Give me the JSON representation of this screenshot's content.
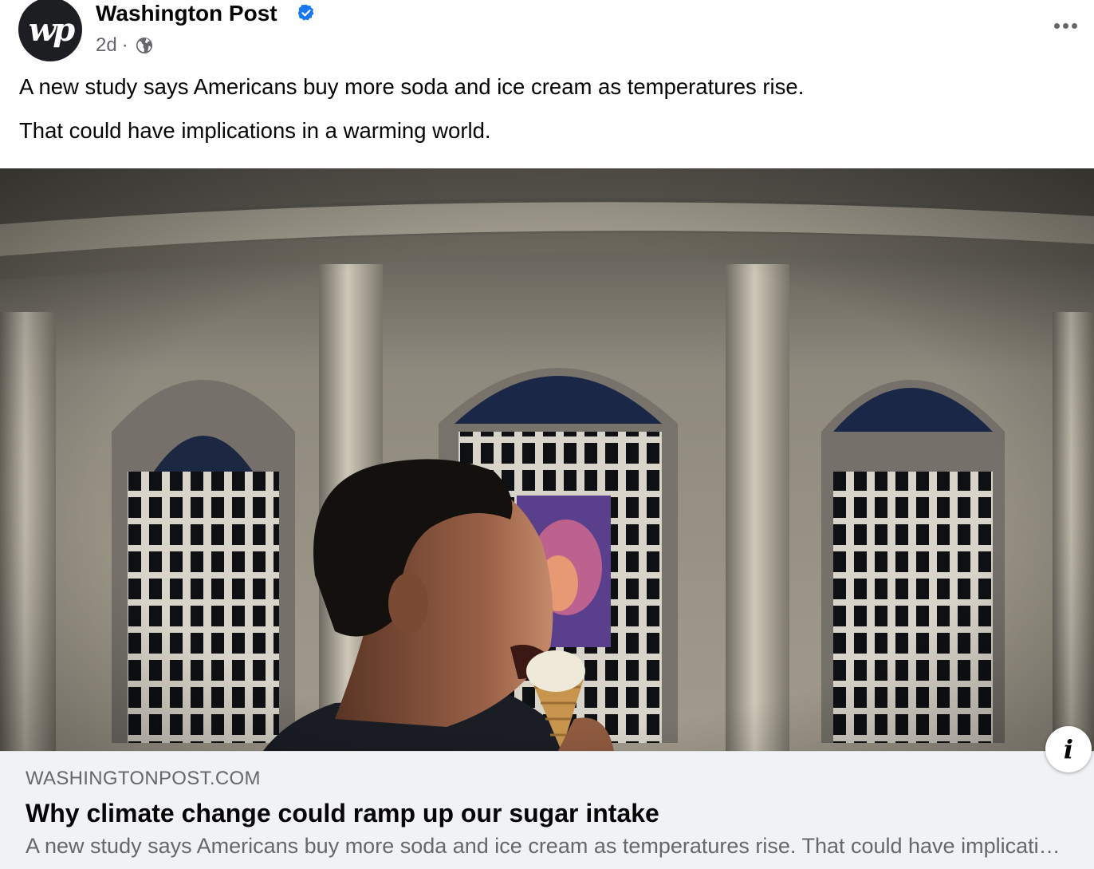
{
  "post": {
    "page_name": "Washington Post",
    "avatar_text": "wp",
    "time": "2d",
    "separator": "·",
    "audience_icon": "globe-icon",
    "verified_icon": "verified-badge-icon",
    "more_icon": "more-options-icon",
    "text_lines": [
      "A new study says Americans buy more soda and ice cream as temperatures rise.",
      "That could have implications in a warming world."
    ]
  },
  "link_preview": {
    "domain": "WASHINGTONPOST.COM",
    "headline": "Why climate change could ramp up our sugar intake",
    "description": "A new study says Americans buy more soda and ice cream as temperatures rise. That could have implications in a warming world.",
    "info_icon": "info-icon"
  },
  "colors": {
    "verified_blue": "#1877f2",
    "secondary_text": "#65676b",
    "card_bg": "#f0f2f5"
  }
}
